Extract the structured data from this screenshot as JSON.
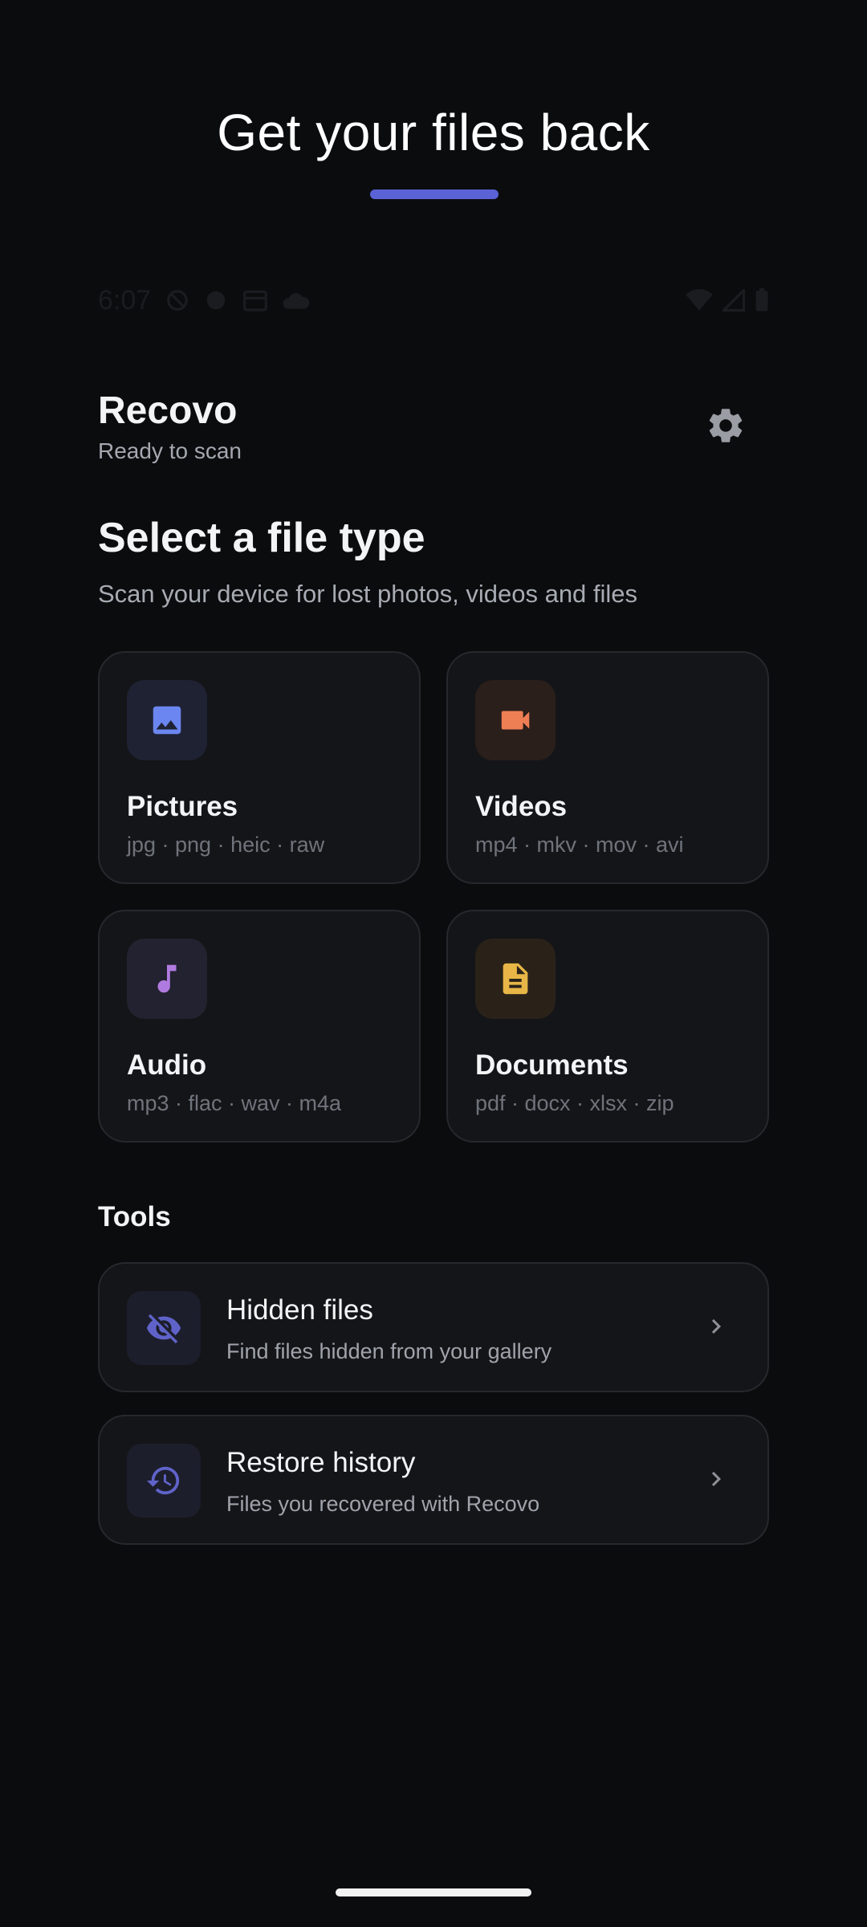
{
  "promo": {
    "title": "Get your files back"
  },
  "status_bar": {
    "time": "6:07"
  },
  "header": {
    "app_name": "Recovo",
    "status": "Ready to scan"
  },
  "section": {
    "title": "Select a file type",
    "subtitle": "Scan your device for lost photos, videos and files"
  },
  "file_types": [
    {
      "label": "Pictures",
      "formats": "jpg · png · heic · raw",
      "icon": "image-icon",
      "color": "#6b86f0",
      "icon_bg": "#1f2233"
    },
    {
      "label": "Videos",
      "formats": "mp4 · mkv · mov · avi",
      "icon": "videocam-icon",
      "color": "#ee7f55",
      "icon_bg": "#2a1f1b"
    },
    {
      "label": "Audio",
      "formats": "mp3 · flac · wav · m4a",
      "icon": "music-note-icon",
      "color": "#b07be0",
      "icon_bg": "#232230"
    },
    {
      "label": "Documents",
      "formats": "pdf · docx · xlsx · zip",
      "icon": "document-icon",
      "color": "#e7b647",
      "icon_bg": "#2a2219"
    }
  ],
  "tools": {
    "title": "Tools",
    "items": [
      {
        "label": "Hidden files",
        "description": "Find files hidden from your gallery",
        "icon": "eye-off-icon",
        "color": "#5f63c9"
      },
      {
        "label": "Restore history",
        "description": "Files you recovered with Recovo",
        "icon": "history-icon",
        "color": "#5f63c9"
      }
    ]
  }
}
